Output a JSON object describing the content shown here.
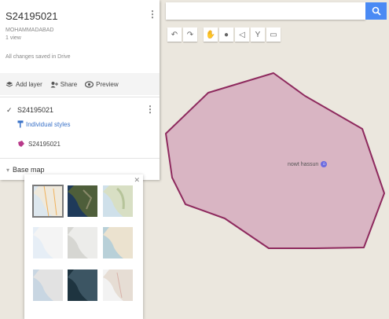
{
  "map_title": "S24195021",
  "subtitle_line1": "MOHAMMADABAD",
  "subtitle_line2": "1 view",
  "save_status": "All changes saved in Drive",
  "actions": {
    "add_layer": "Add layer",
    "share": "Share",
    "preview": "Preview"
  },
  "layer": {
    "name": "S24195021",
    "style_link": "Individual styles",
    "feature_name": "S24195021"
  },
  "basemap": {
    "label": "Base map",
    "tile_count": 9,
    "selected_tile": 0
  },
  "place_label": "nowt hassun",
  "colors": {
    "polygon_fill": "#d9b5c3",
    "polygon_stroke": "#8e2a5e",
    "search_button": "#4a8af4",
    "link": "#3a72c8",
    "feature_pin": "#b83a8a"
  },
  "icons": {
    "search": "search-icon",
    "kebab": "more-vert-icon",
    "add_layer": "layers-icon",
    "share": "share-icon",
    "preview": "eye-icon",
    "check": "check-icon",
    "paint": "paint-roller-icon",
    "polygon": "polygon-icon",
    "basemap_toggle": "chevron-icon",
    "close": "close-icon",
    "place": "place-marker-icon"
  }
}
